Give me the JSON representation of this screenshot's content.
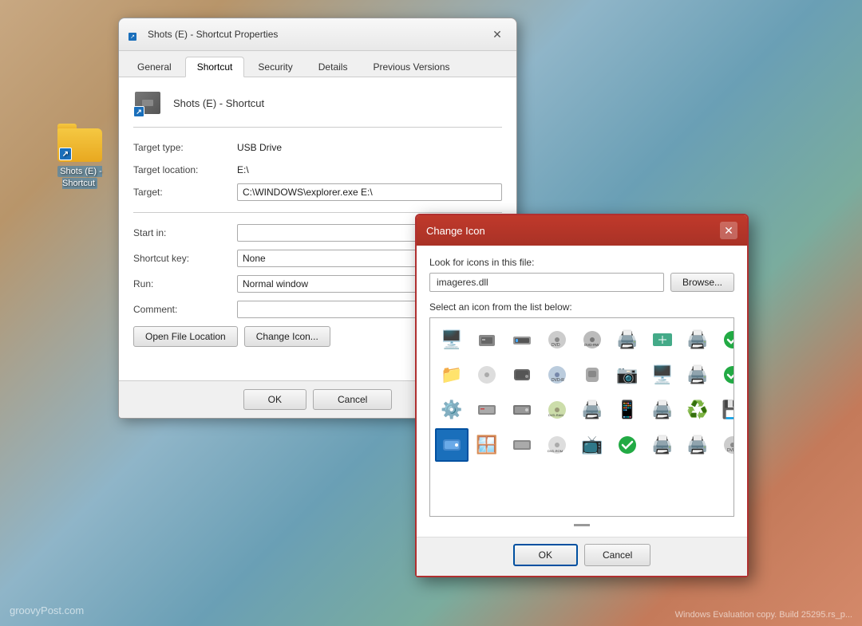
{
  "desktop": {
    "folder_label": "Shots (E) -\nShortcut",
    "watermark_left": "groovyPost.com",
    "watermark_right": "Windows\nEvaluation copy. Build 25295.rs_p..."
  },
  "properties_window": {
    "title": "Shots (E) - Shortcut Properties",
    "tabs": [
      "General",
      "Shortcut",
      "Security",
      "Details",
      "Previous Versions"
    ],
    "active_tab": "Shortcut",
    "file_name": "Shots (E) - Shortcut",
    "fields": {
      "target_type_label": "Target type:",
      "target_type_value": "USB Drive",
      "target_location_label": "Target location:",
      "target_location_value": "E:\\",
      "target_label": "Target:",
      "target_value": "C:\\WINDOWS\\explorer.exe E:\\",
      "start_in_label": "Start in:",
      "start_in_value": "",
      "shortcut_key_label": "Shortcut key:",
      "shortcut_key_value": "None",
      "run_label": "Run:",
      "run_value": "Normal window",
      "comment_label": "Comment:",
      "comment_value": ""
    },
    "buttons": {
      "open_file_location": "Open File Location",
      "change_icon": "Change Icon..."
    },
    "footer": {
      "ok": "OK",
      "cancel": "Cancel"
    }
  },
  "change_icon_dialog": {
    "title": "Change Icon",
    "file_label": "Look for icons in this file:",
    "file_value": "imageres.dll",
    "browse_label": "Browse...",
    "icon_grid_label": "Select an icon from the list below:",
    "icons": [
      {
        "id": 1,
        "emoji": "🖥️",
        "selected": false
      },
      {
        "id": 2,
        "emoji": "🖨️",
        "selected": false
      },
      {
        "id": 3,
        "emoji": "📠",
        "selected": false
      },
      {
        "id": 4,
        "emoji": "💿",
        "selected": false,
        "label": "DVD"
      },
      {
        "id": 5,
        "emoji": "📀",
        "selected": false,
        "label": "DVD-RW"
      },
      {
        "id": 6,
        "emoji": "🖨️",
        "selected": false
      },
      {
        "id": 7,
        "emoji": "📶",
        "selected": false
      },
      {
        "id": 8,
        "emoji": "🖨️",
        "selected": false
      },
      {
        "id": 9,
        "emoji": "✅",
        "selected": false
      },
      {
        "id": 10,
        "emoji": "📁",
        "selected": false
      },
      {
        "id": 11,
        "emoji": "📁",
        "selected": false
      },
      {
        "id": 12,
        "emoji": "💽",
        "selected": false
      },
      {
        "id": 13,
        "emoji": "🖥️",
        "selected": false
      },
      {
        "id": 14,
        "emoji": "💿",
        "selected": false,
        "label": "DVD-R"
      },
      {
        "id": 15,
        "emoji": "🖱️",
        "selected": false
      },
      {
        "id": 16,
        "emoji": "📷",
        "selected": false
      },
      {
        "id": 17,
        "emoji": "🖥️",
        "selected": false
      },
      {
        "id": 18,
        "emoji": "🖨️",
        "selected": false
      },
      {
        "id": 19,
        "emoji": "✅",
        "selected": false
      },
      {
        "id": 20,
        "emoji": "♻️",
        "selected": false
      },
      {
        "id": 21,
        "emoji": "⚙️",
        "selected": false
      },
      {
        "id": 22,
        "emoji": "💽",
        "selected": false
      },
      {
        "id": 23,
        "emoji": "🖥️",
        "selected": false
      },
      {
        "id": 24,
        "emoji": "💿",
        "selected": false,
        "label": "DVD-RAM"
      },
      {
        "id": 25,
        "emoji": "🖨️",
        "selected": false
      },
      {
        "id": 26,
        "emoji": "📱",
        "selected": false
      },
      {
        "id": 27,
        "emoji": "🖨️",
        "selected": false
      },
      {
        "id": 28,
        "emoji": "♻️",
        "selected": false
      },
      {
        "id": 29,
        "emoji": "💾",
        "selected": false
      },
      {
        "id": 30,
        "emoji": "💻",
        "selected": true
      },
      {
        "id": 31,
        "emoji": "🪟",
        "selected": false
      },
      {
        "id": 32,
        "emoji": "🖥️",
        "selected": false
      },
      {
        "id": 33,
        "emoji": "💿",
        "selected": false,
        "label": "DVD-ROM"
      },
      {
        "id": 34,
        "emoji": "📺",
        "selected": false
      },
      {
        "id": 35,
        "emoji": "✅",
        "selected": false
      },
      {
        "id": 36,
        "emoji": "🖨️",
        "selected": false
      },
      {
        "id": 37,
        "emoji": "🖨️",
        "selected": false
      },
      {
        "id": 38,
        "emoji": "💿",
        "selected": false,
        "label": "DVD"
      },
      {
        "id": 39,
        "emoji": "💽",
        "selected": false
      },
      {
        "id": 40,
        "emoji": "🖥️",
        "selected": false
      }
    ],
    "footer": {
      "ok": "OK",
      "cancel": "Cancel"
    }
  }
}
